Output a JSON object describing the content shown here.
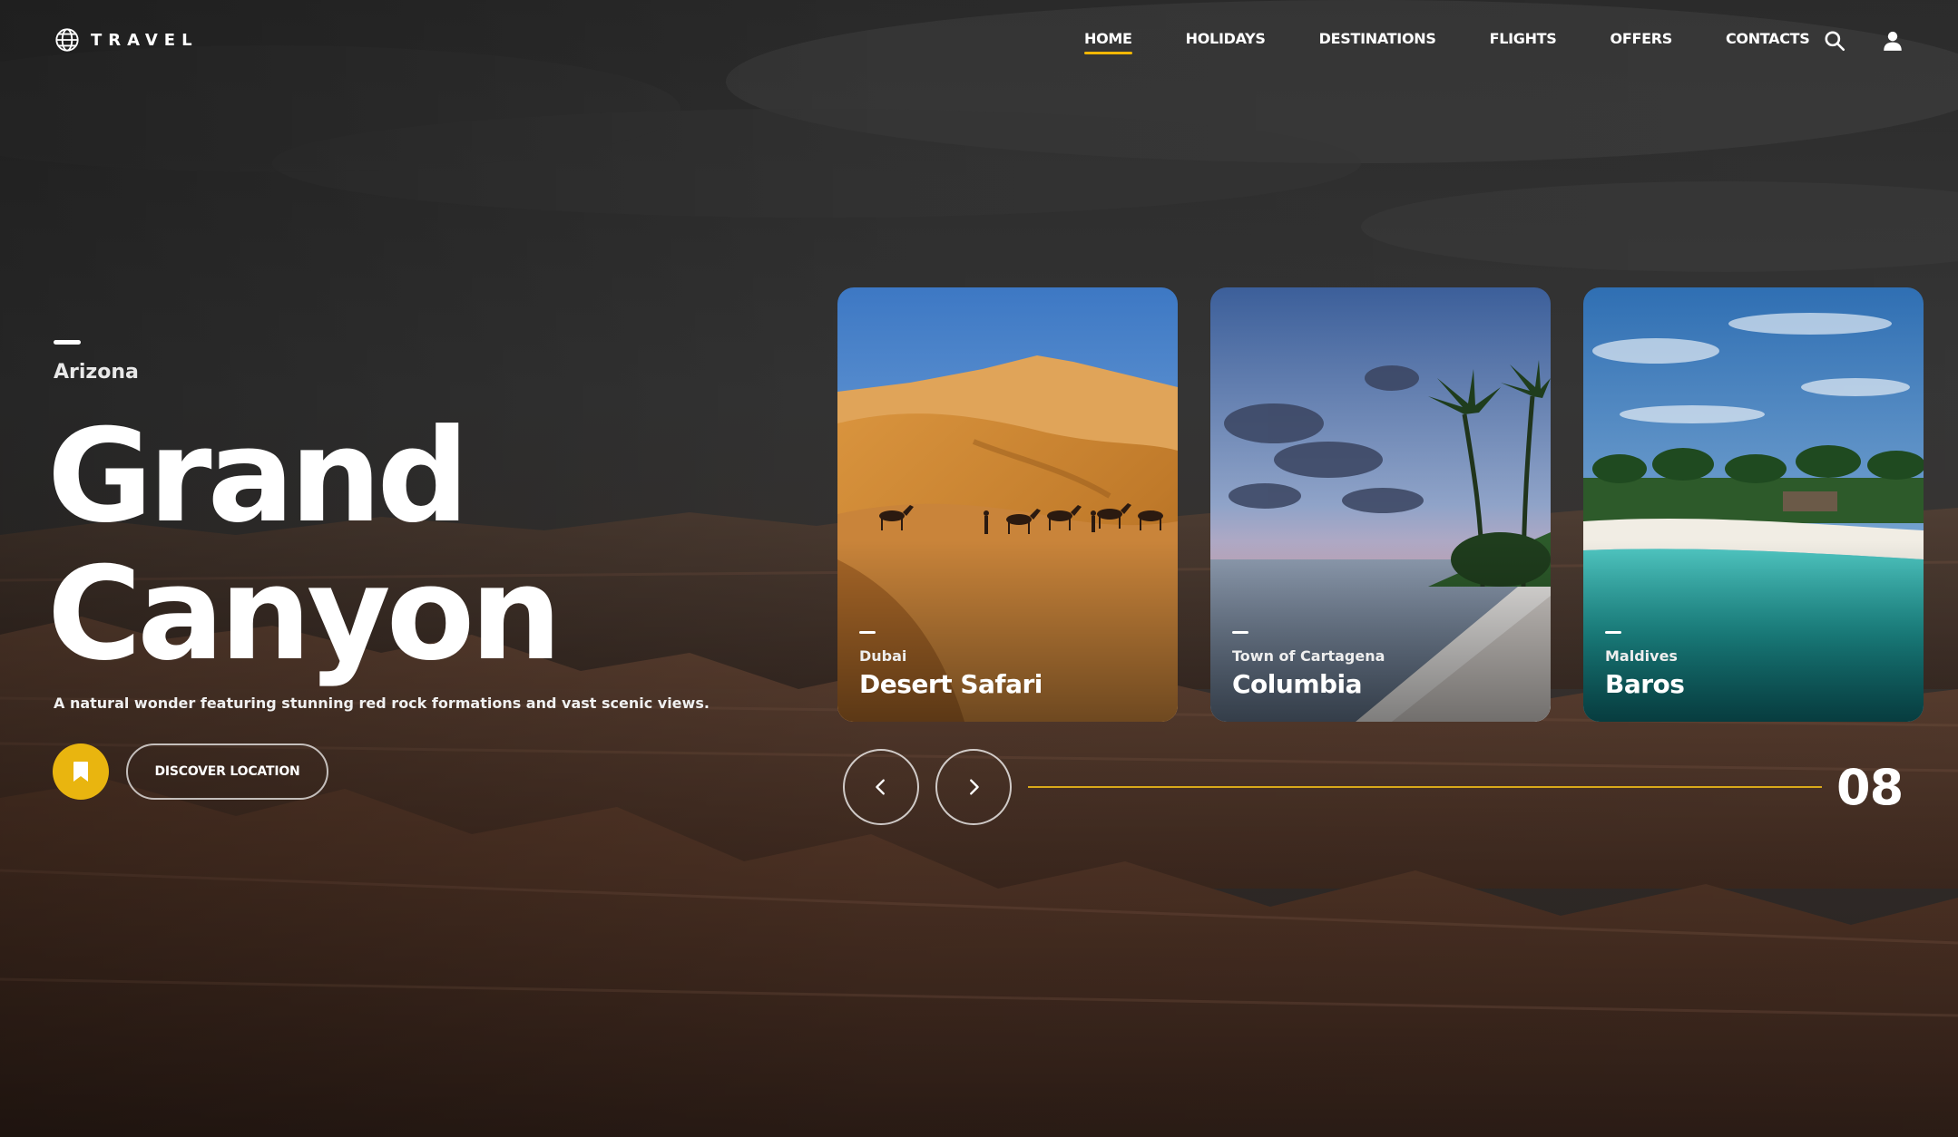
{
  "brand": {
    "name": "TRAVEL",
    "icon": "globe-icon"
  },
  "nav": {
    "items": [
      {
        "label": "HOME",
        "active": true
      },
      {
        "label": "HOLIDAYS",
        "active": false
      },
      {
        "label": "DESTINATIONS",
        "active": false
      },
      {
        "label": "FLIGHTS",
        "active": false
      },
      {
        "label": "OFFERS",
        "active": false
      },
      {
        "label": "CONTACTS",
        "active": false
      }
    ],
    "icons": [
      "search-icon",
      "user-icon"
    ],
    "active_color": "#f2b705"
  },
  "hero": {
    "region": "Arizona",
    "title_line1": "Grand",
    "title_line2": "Canyon",
    "description": "A natural wonder featuring stunning red rock formations and vast scenic views.",
    "bookmark_icon": "bookmark-icon",
    "cta_label": "DISCOVER LOCATION",
    "accent_color": "#e9b50f"
  },
  "cards": [
    {
      "subtitle": "Dubai",
      "title": "Desert Safari",
      "scene": "desert-dunes-camels"
    },
    {
      "subtitle": "Town of Cartagena",
      "title": "Columbia",
      "scene": "tropical-beach-sunset"
    },
    {
      "subtitle": "Maldives",
      "title": "Baros",
      "scene": "turquoise-lagoon-palms"
    }
  ],
  "slider": {
    "prev_icon": "chevron-left-icon",
    "next_icon": "chevron-right-icon",
    "current_slide": "08",
    "progress": 1.0
  }
}
